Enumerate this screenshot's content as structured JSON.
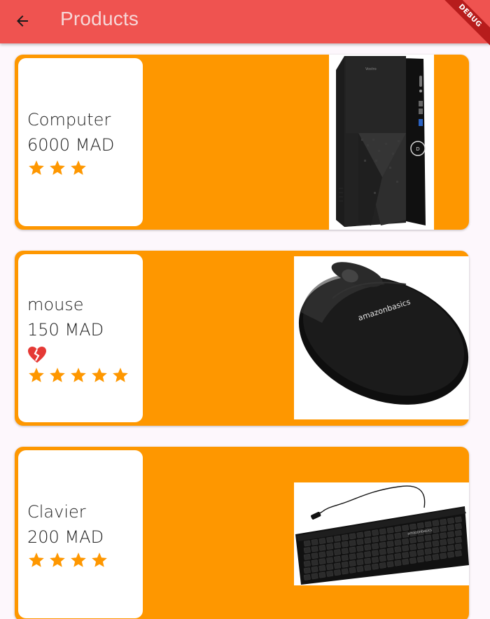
{
  "appbar": {
    "title": "Products",
    "back_icon": "arrow-back-icon",
    "background": "#ef5350"
  },
  "debug_banner": {
    "label": "DEBUG"
  },
  "theme": {
    "card_color": "#fe9700",
    "star_color": "#fe9700",
    "heart_color": "#e53935"
  },
  "products": [
    {
      "name": "Computer",
      "price": "6000 MAD",
      "rating": 3,
      "favorite_broken": false,
      "image_icon": "desktop-tower-image"
    },
    {
      "name": "mouse",
      "price": "150 MAD",
      "rating": 5,
      "favorite_broken": true,
      "image_icon": "computer-mouse-image",
      "image_text": "amazonbasics"
    },
    {
      "name": "Clavier",
      "price": "200 MAD",
      "rating": 4,
      "favorite_broken": false,
      "image_icon": "keyboard-image",
      "image_text": "amazonbasics"
    }
  ]
}
